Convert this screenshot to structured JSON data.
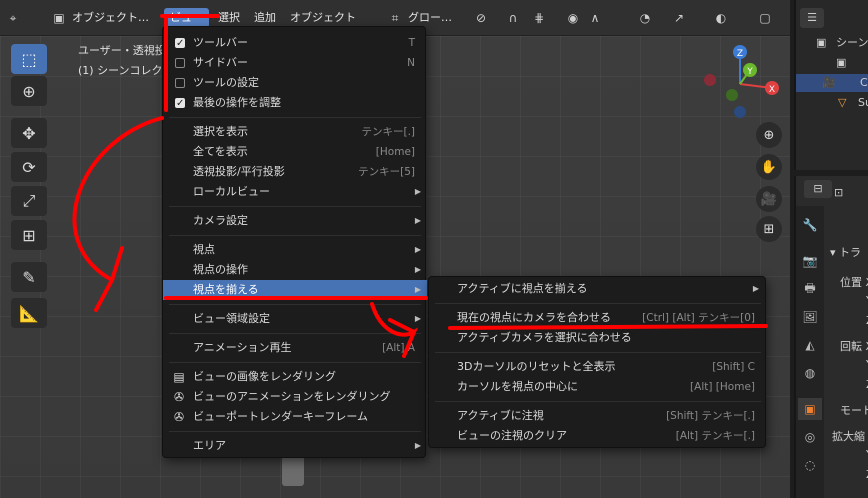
{
  "header": {
    "mode_label": "オブジェクト…",
    "menus": [
      "ビュー",
      "選択",
      "追加",
      "オブジェクト"
    ],
    "orientation_label": "グロー…"
  },
  "viewport": {
    "line1": "ユーザー・透視投",
    "line2": "(1) シーンコレク"
  },
  "menu": {
    "items": [
      {
        "label": "ツールバー",
        "shortcut": "T"
      },
      {
        "label": "サイドバー",
        "shortcut": "N"
      },
      {
        "label": "ツールの設定",
        "shortcut": ""
      },
      {
        "label": "最後の操作を調整",
        "shortcut": ""
      },
      {
        "label": "選択を表示",
        "shortcut": "テンキー[.]"
      },
      {
        "label": "全てを表示",
        "shortcut": "[Home]"
      },
      {
        "label": "透視投影/平行投影",
        "shortcut": "テンキー[5]"
      },
      {
        "label": "ローカルビュー",
        "shortcut": ""
      },
      {
        "label": "カメラ設定",
        "shortcut": ""
      },
      {
        "label": "視点",
        "shortcut": ""
      },
      {
        "label": "視点の操作",
        "shortcut": ""
      },
      {
        "label": "視点を揃える",
        "shortcut": ""
      },
      {
        "label": "ビュー領域設定",
        "shortcut": ""
      },
      {
        "label": "アニメーション再生",
        "shortcut": "[Alt] A"
      },
      {
        "label": "ビューの画像をレンダリング",
        "shortcut": ""
      },
      {
        "label": "ビューのアニメーションをレンダリング",
        "shortcut": ""
      },
      {
        "label": "ビューポートレンダーキーフレーム",
        "shortcut": ""
      },
      {
        "label": "エリア",
        "shortcut": ""
      }
    ]
  },
  "submenu": {
    "items": [
      {
        "label": "アクティブに視点を揃える",
        "shortcut": ""
      },
      {
        "label": "現在の視点にカメラを合わせる",
        "shortcut": "[Ctrl] [Alt] テンキー[0]"
      },
      {
        "label": "アクティブカメラを選択に合わせる",
        "shortcut": ""
      },
      {
        "label": "3Dカーソルのリセットと全表示",
        "shortcut": "[Shift] C"
      },
      {
        "label": "カーソルを視点の中心に",
        "shortcut": "[Alt] [Home]"
      },
      {
        "label": "アクティブに注視",
        "shortcut": "[Shift] テンキー[.]"
      },
      {
        "label": "ビューの注視のクリア",
        "shortcut": "[Alt] テンキー[.]"
      }
    ]
  },
  "outliner": {
    "items": [
      "シーン",
      "Ca",
      "Su"
    ]
  },
  "properties": {
    "section": "トラ",
    "labels": [
      "位置 X",
      "Y",
      "Z",
      "回転 X",
      "Y",
      "Z",
      "モード",
      "拡大縮",
      "Y",
      "Z"
    ]
  },
  "gizmo": {
    "x": "X",
    "y": "Y",
    "z": "Z"
  },
  "colors": {
    "accent": "#4772b3",
    "annotation": "#ff0000"
  }
}
